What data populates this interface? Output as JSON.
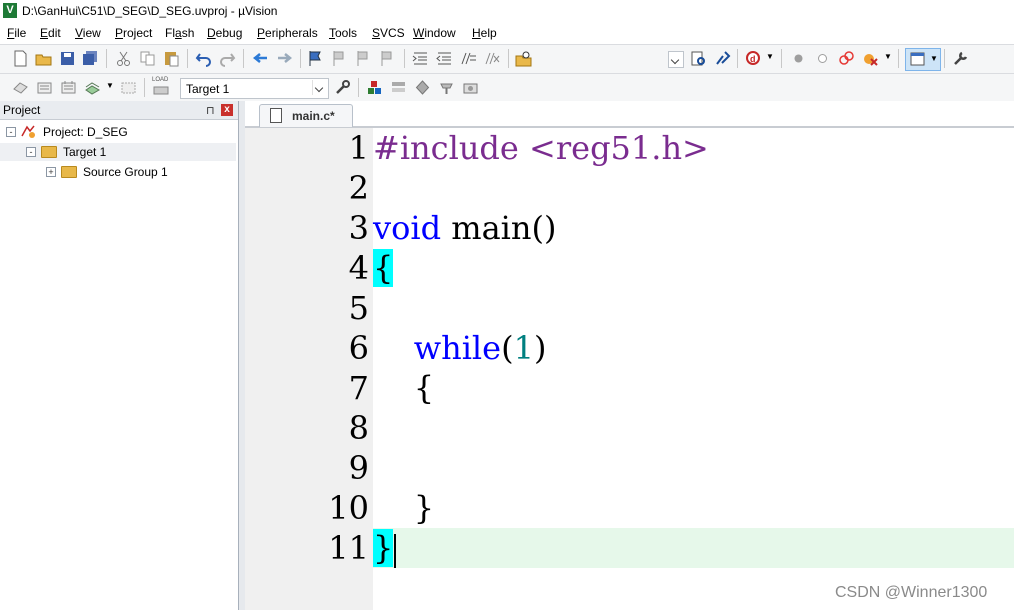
{
  "window": {
    "title": "D:\\GanHui\\C51\\D_SEG\\D_SEG.uvproj - µVision",
    "app_icon_letter": "V"
  },
  "menu": [
    {
      "label": "File",
      "key": "F"
    },
    {
      "label": "Edit",
      "key": "E"
    },
    {
      "label": "View",
      "key": "V"
    },
    {
      "label": "Project",
      "key": "P"
    },
    {
      "label": "Flash",
      "key": "a"
    },
    {
      "label": "Debug",
      "key": "D"
    },
    {
      "label": "Peripherals",
      "key": "P"
    },
    {
      "label": "Tools",
      "key": "T"
    },
    {
      "label": "SVCS",
      "key": "S"
    },
    {
      "label": "Window",
      "key": "W"
    },
    {
      "label": "Help",
      "key": "H"
    }
  ],
  "toolbar2": {
    "target_value": "Target 1",
    "load_label": "LOAD"
  },
  "project_panel": {
    "title": "Project",
    "pin_glyph": "⊓",
    "close_glyph": "x",
    "tree": [
      {
        "label": "Project: D_SEG",
        "expander": "-"
      },
      {
        "label": "Target 1",
        "expander": "-"
      },
      {
        "label": "Source Group 1",
        "expander": "+"
      }
    ]
  },
  "editor": {
    "tab_label": "main.c*",
    "lines": [
      {
        "n": "1"
      },
      {
        "n": "2"
      },
      {
        "n": "3"
      },
      {
        "n": "4"
      },
      {
        "n": "5"
      },
      {
        "n": "6"
      },
      {
        "n": "7"
      },
      {
        "n": "8"
      },
      {
        "n": "9"
      },
      {
        "n": "10"
      },
      {
        "n": "11"
      }
    ],
    "code": {
      "l1": "#include <reg51.h>",
      "l3_kw": "void",
      "l3_rest": " main()",
      "l4": "{",
      "l6_indent": "    ",
      "l6_kw": "while",
      "l6_open": "(",
      "l6_num": "1",
      "l6_close": ")",
      "l7": "    {",
      "l10": "    }",
      "l11": "}"
    }
  },
  "watermark": "CSDN @Winner1300",
  "colors": {
    "keyword": "#0000ff",
    "preprocessor": "#7a2c8f",
    "number": "#008080",
    "brace_match": "#00ffff",
    "current_line": "#e6f8ea"
  }
}
